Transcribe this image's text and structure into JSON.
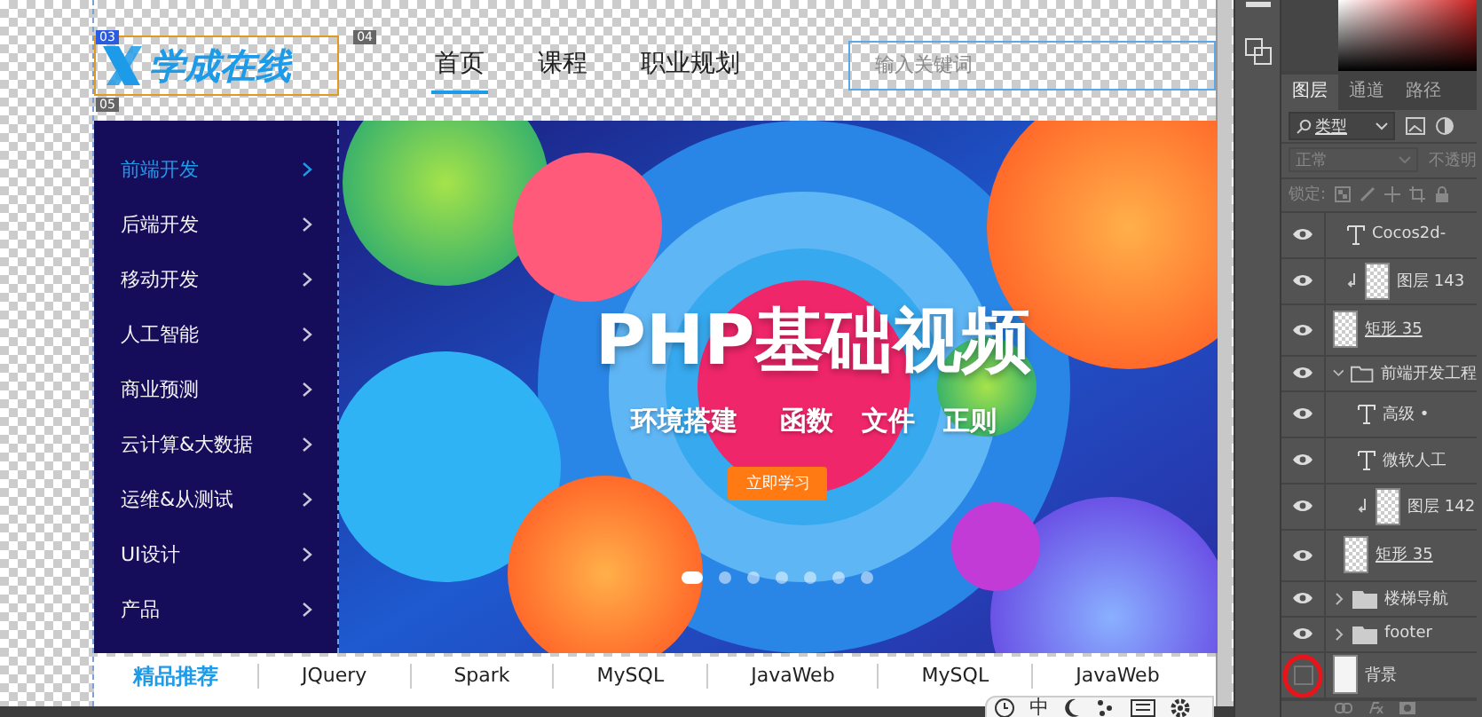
{
  "canvas": {
    "logo": {
      "text": "学成在线"
    },
    "guide_badges": [
      "03",
      "04",
      "05"
    ],
    "nav": [
      {
        "label": "首页",
        "selected": true
      },
      {
        "label": "课程",
        "selected": false
      },
      {
        "label": "职业规划",
        "selected": false
      }
    ],
    "search": {
      "placeholder": "输入关键词"
    },
    "sidebar": [
      {
        "label": "前端开发",
        "selected": true
      },
      {
        "label": "后端开发",
        "selected": false
      },
      {
        "label": "移动开发",
        "selected": false
      },
      {
        "label": "人工智能",
        "selected": false
      },
      {
        "label": "商业预测",
        "selected": false
      },
      {
        "label": "云计算&大数据",
        "selected": false
      },
      {
        "label": "运维&从测试",
        "selected": false
      },
      {
        "label": "UI设计",
        "selected": false
      },
      {
        "label": "产品",
        "selected": false
      }
    ],
    "banner": {
      "title": "PHP基础视频",
      "tags": [
        "环境搭建",
        "函数",
        "文件",
        "正则"
      ],
      "button": "立即学习",
      "dots": [
        {
          "selected": true
        },
        {
          "selected": false
        },
        {
          "selected": false
        },
        {
          "selected": false
        },
        {
          "selected": false
        },
        {
          "selected": false
        },
        {
          "selected": false
        }
      ]
    },
    "recommend": {
      "heading": "精品推荐",
      "items": [
        "JQuery",
        "Spark",
        "MySQL",
        "JavaWeb",
        "MySQL",
        "JavaWeb"
      ]
    }
  },
  "ime_bar": {
    "label": "中"
  },
  "layers_panel": {
    "tabs": [
      {
        "label": "图层",
        "selected": true
      },
      {
        "label": "通道",
        "selected": false
      },
      {
        "label": "路径",
        "selected": false
      }
    ],
    "filter": "类型",
    "blend_mode": "正常",
    "opacity_label": "不透明",
    "lock_label": "锁定:",
    "rows": [
      {
        "kind": "text",
        "name": "Cocos2d-",
        "visible": true
      },
      {
        "kind": "image",
        "name": "图层 143",
        "visible": true,
        "clipped": true
      },
      {
        "kind": "shape",
        "name": "矩形 35",
        "visible": true
      },
      {
        "kind": "group",
        "name": "前端开发工程",
        "visible": true,
        "expanded": true,
        "children": [
          {
            "kind": "text",
            "name": "高级 •",
            "visible": true
          },
          {
            "kind": "text",
            "name": "微软人工",
            "visible": true
          },
          {
            "kind": "image",
            "name": "图层 142",
            "visible": true,
            "clipped": true
          },
          {
            "kind": "shape",
            "name": "矩形 35",
            "visible": true
          }
        ]
      },
      {
        "kind": "group",
        "name": "楼梯导航",
        "visible": true,
        "expanded": false
      },
      {
        "kind": "group",
        "name": "footer",
        "visible": true,
        "expanded": false
      },
      {
        "kind": "background",
        "name": "背景",
        "visible": false
      }
    ]
  }
}
